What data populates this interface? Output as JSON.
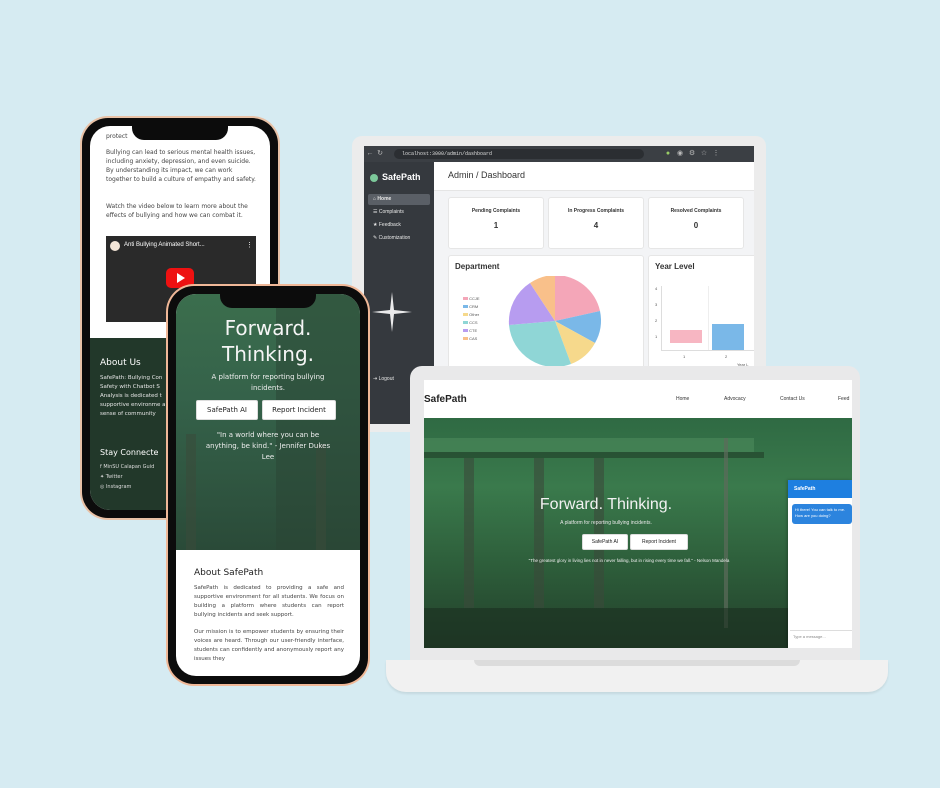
{
  "dashboard": {
    "url": "localhost:3000/admin/dashboard",
    "brand": "SafePath",
    "nav": [
      "Home",
      "Complaints",
      "Feedback",
      "Customization"
    ],
    "logout": "Logout",
    "header": "Admin / Dashboard",
    "cards": [
      {
        "label": "Pending Complaints",
        "value": "1"
      },
      {
        "label": "In Progress Complaints",
        "value": "4"
      },
      {
        "label": "Resolved Complaints",
        "value": "0"
      }
    ],
    "department": {
      "title": "Department",
      "legend": [
        "CCJE",
        "CRM",
        "Other",
        "CCS",
        "CTE",
        "CAS"
      ]
    },
    "year_level": {
      "title": "Year Level",
      "ticks": [
        "4",
        "3",
        "2",
        "1"
      ],
      "x_ticks": [
        "1",
        "2"
      ],
      "x_label": "Year L"
    }
  },
  "laptop_site": {
    "brand": "SafePath",
    "nav": [
      "Home",
      "Advocacy",
      "Contact Us",
      "Feed"
    ],
    "hero_title": "Forward. Thinking.",
    "hero_sub": "A platform for reporting bullying incidents.",
    "btn_ai": "SafePath AI",
    "btn_report": "Report Incident",
    "quote": "\"The greatest glory in living lies not in never falling, but in rising every time we fall.\" - Nelson Mandela",
    "chat": {
      "title": "SafePath",
      "bubble": "Hi there! You can talk to me. How are you doing?",
      "placeholder": "Type a message..."
    }
  },
  "phone1": {
    "top_cut": "protect",
    "para1": "Bullying can lead to serious mental health issues, including anxiety, depression, and even suicide. By understanding its impact, we can work together to build a culture of empathy and safety.",
    "para2": "Watch the video below to learn more about the effects of bullying and how we can combat it.",
    "video_title": "Anti Bullying Animated Short...",
    "about_title": "About Us",
    "about_text": "SafePath: Bullying Con Safety with Chatbot S Analysis is dedicated t supportive environme a sense of community",
    "stay": "Stay Connecte",
    "social": [
      "MinSU Calapan Guid",
      "Twitter",
      "Instagram"
    ]
  },
  "phone2": {
    "hero_title1": "Forward.",
    "hero_title2": "Thinking.",
    "hero_sub": "A platform for reporting bullying incidents.",
    "btn_ai": "SafePath AI",
    "btn_report": "Report Incident",
    "quote": "\"In a world where you can be anything, be kind.\" - Jennifer Dukes Lee",
    "about_title": "About SafePath",
    "about_p1": "SafePath is dedicated to providing a safe and supportive environment for all students. We focus on building a platform where students can report bullying incidents and seek support.",
    "about_p2": "Our mission is to empower students by ensuring their voices are heard. Through our user-friendly interface, students can confidently and anonymously report any issues they"
  },
  "colors": {
    "background": "#d6ebf2",
    "sidebar": "#35393e",
    "hero_green": "#2f6a43",
    "chat_blue": "#1e7fe0",
    "pie": [
      "#f4a6b8",
      "#7ab8e8",
      "#f6d98c",
      "#8fd6d6",
      "#b79cf0",
      "#f9c08a"
    ]
  }
}
